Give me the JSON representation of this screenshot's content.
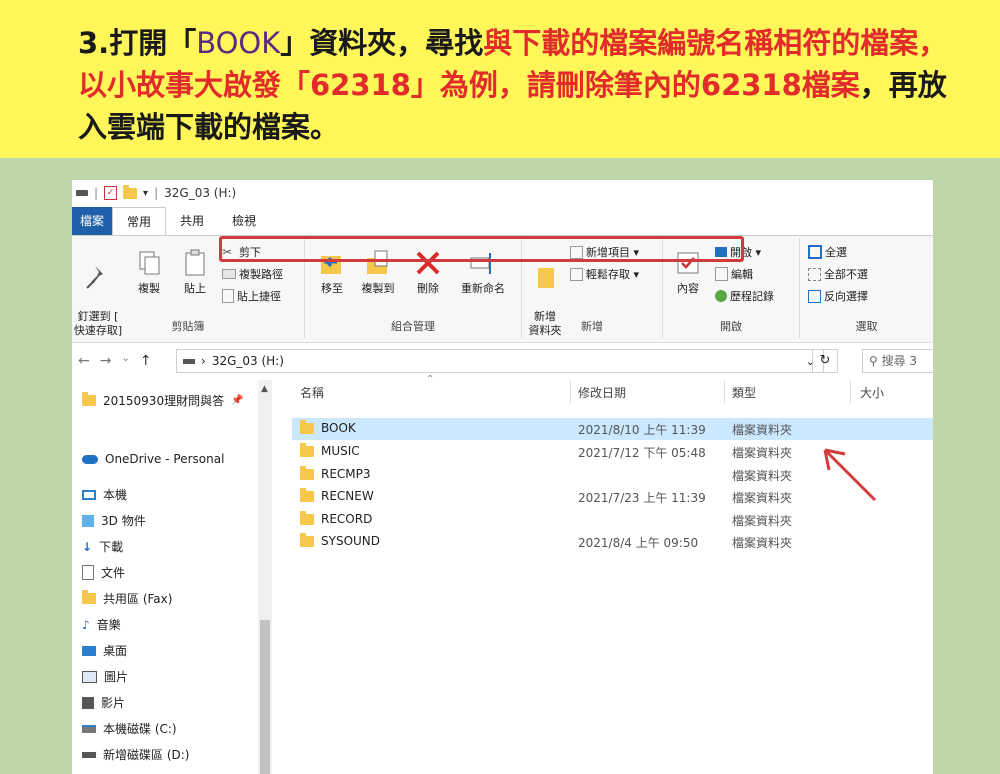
{
  "instruction": {
    "prefix": "3.打開「",
    "folder_name": "BOOK",
    "middle": "」資料夾，尋找",
    "red1": "與下載的檔案編號名稱相符的檔案，以小故事大啟發「62318」為例，請刪除筆內的62318檔案",
    "suffix": "，再放入雲端下載的檔案。"
  },
  "quick_access": {
    "title": "32G_03 (H:)"
  },
  "tabs": {
    "file": "檔案",
    "home": "常用",
    "share": "共用",
    "view": "檢視"
  },
  "ribbon": {
    "pin": "釘選到 [\n快速存取]",
    "copy": "複製",
    "paste": "貼上",
    "cut": "剪下",
    "copy_path": "複製路徑",
    "paste_shortcut": "貼上捷徑",
    "clipboard_label": "剪貼簿",
    "move_to": "移至",
    "copy_to": "複製到",
    "delete": "刪除",
    "rename": "重新命名",
    "organize_label": "組合管理",
    "new_folder": "新增\n資料夾",
    "new_item": "新增項目 ▾",
    "easy_access": "輕鬆存取 ▾",
    "new_label": "新增",
    "properties": "內容",
    "open": "開啟 ▾",
    "edit": "編輯",
    "history": "歷程記錄",
    "open_label": "開啟",
    "select_all": "全選",
    "select_none": "全部不選",
    "invert": "反向選擇",
    "select_label": "選取"
  },
  "address": {
    "drive": "32G_03 (H:)",
    "search_placeholder": "搜尋 3"
  },
  "nav": [
    {
      "label": "20150930理財問與答",
      "icon": "folder-icon"
    },
    {
      "label": "OneDrive - Personal",
      "icon": "cloud-icon"
    },
    {
      "label": "本機",
      "icon": "pc-icon"
    },
    {
      "label": "3D 物件",
      "icon": "cube-icon"
    },
    {
      "label": "下載",
      "icon": "download-icon"
    },
    {
      "label": "文件",
      "icon": "document-icon"
    },
    {
      "label": "共用區 (Fax)",
      "icon": "folder-icon"
    },
    {
      "label": "音樂",
      "icon": "music-icon"
    },
    {
      "label": "桌面",
      "icon": "desktop-icon"
    },
    {
      "label": "圖片",
      "icon": "picture-icon"
    },
    {
      "label": "影片",
      "icon": "video-icon"
    },
    {
      "label": "本機磁碟 (C:)",
      "icon": "disk-icon"
    },
    {
      "label": "新增磁碟區 (D:)",
      "icon": "disk-icon"
    }
  ],
  "columns": {
    "name": "名稱",
    "date": "修改日期",
    "type": "類型",
    "size": "大小"
  },
  "files": [
    {
      "name": "BOOK",
      "date": "2021/8/10 上午 11:39",
      "type": "檔案資料夾"
    },
    {
      "name": "MUSIC",
      "date": "2021/7/12 下午 05:48",
      "type": "檔案資料夾"
    },
    {
      "name": "RECMP3",
      "date": "",
      "type": "檔案資料夾"
    },
    {
      "name": "RECNEW",
      "date": "2021/7/23 上午 11:39",
      "type": "檔案資料夾"
    },
    {
      "name": "RECORD",
      "date": "",
      "type": "檔案資料夾"
    },
    {
      "name": "SYSOUND",
      "date": "2021/8/4 上午 09:50",
      "type": "檔案資料夾"
    }
  ],
  "colors": {
    "highlight_box": "#d23b3b",
    "banner_bg": "#fff65a",
    "page_bg": "#bfd7a8",
    "accent_text": "#e22b2b"
  }
}
